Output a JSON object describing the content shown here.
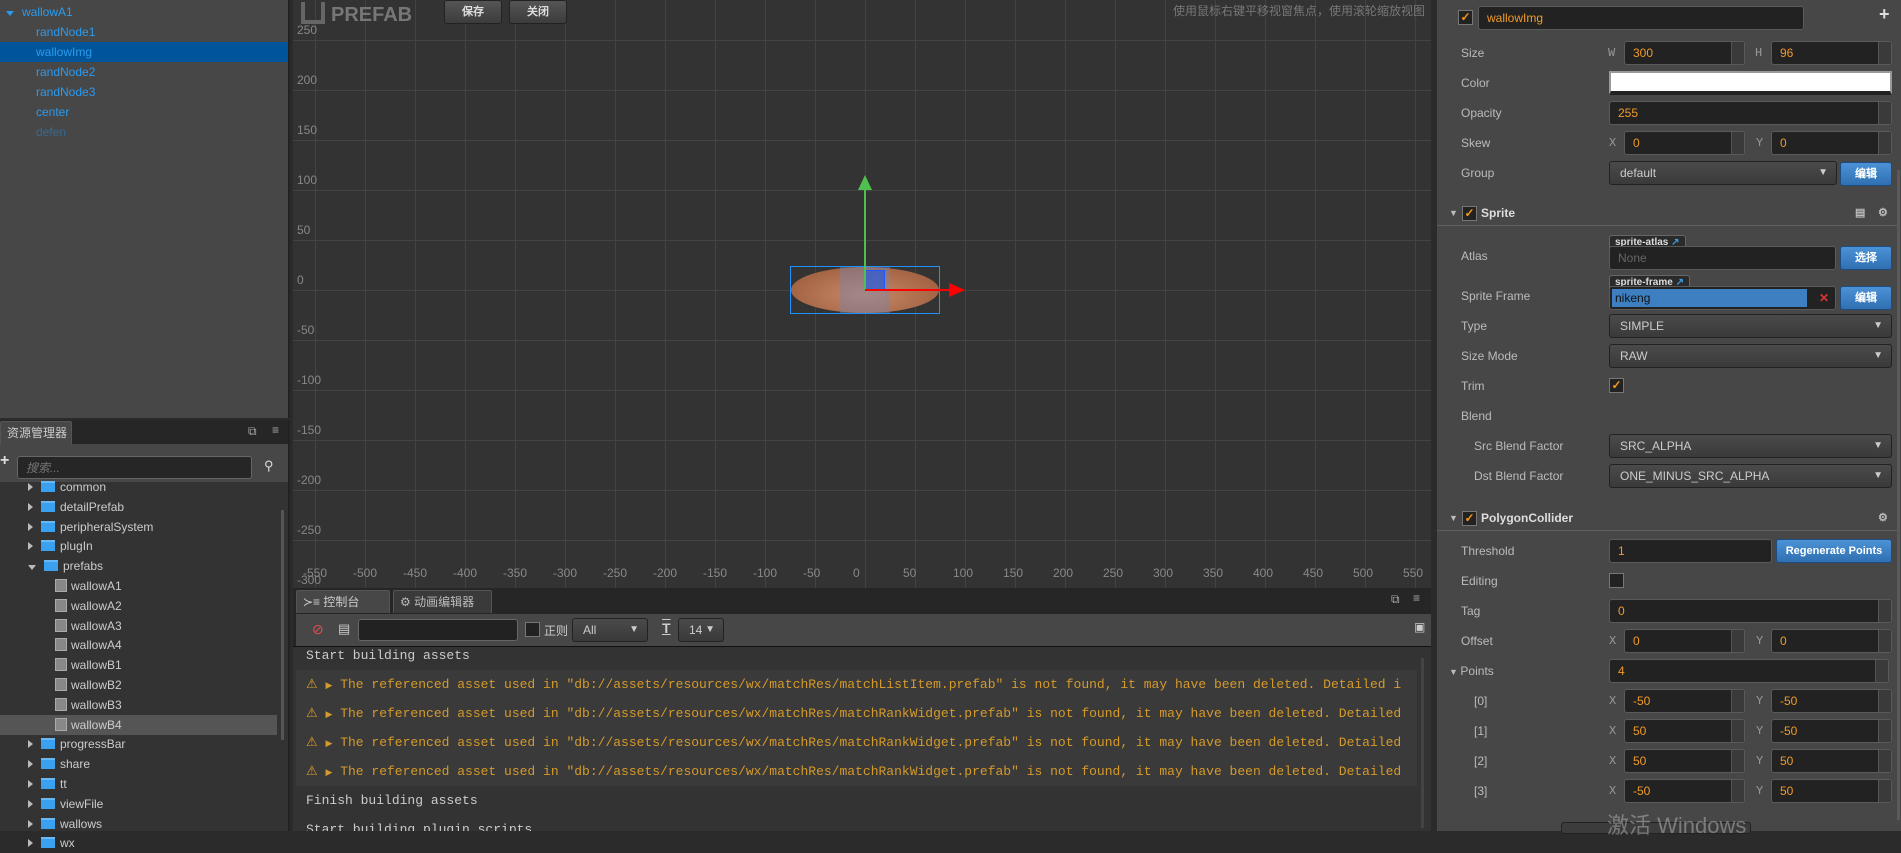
{
  "hierarchy": {
    "root": "wallowA1",
    "items": [
      "randNode1",
      "wallowImg",
      "randNode2",
      "randNode3",
      "center",
      "defen"
    ],
    "selected": "wallowImg"
  },
  "assets": {
    "tab": "资源管理器",
    "search_placeholder": "搜索...",
    "folders_top": [
      "common",
      "detailPrefab",
      "peripheralSystem",
      "plugIn",
      "prefabs"
    ],
    "prefabs": [
      "wallowA1",
      "wallowA2",
      "wallowA3",
      "wallowA4",
      "wallowB1",
      "wallowB2",
      "wallowB3",
      "wallowB4"
    ],
    "folders_bottom": [
      "progressBar",
      "share",
      "tt",
      "viewFile",
      "wallows",
      "wx"
    ],
    "selected": "wallowB4"
  },
  "scene": {
    "mode": "PREFAB",
    "save": "保存",
    "close": "关闭",
    "hint": "使用鼠标右键平移视窗焦点，使用滚轮缩放视图",
    "x_ticks": [
      -550,
      -500,
      -450,
      -400,
      -350,
      -300,
      -250,
      -200,
      -150,
      -100,
      -50,
      0,
      50,
      100,
      150,
      200,
      250,
      300,
      350,
      400,
      450,
      500,
      550
    ],
    "y_ticks": [
      250,
      200,
      150,
      100,
      50,
      0,
      -50,
      -100,
      -150,
      -200,
      -250,
      -300
    ],
    "node": {
      "width": 300,
      "height": 96
    }
  },
  "console": {
    "tab_console": "控制台",
    "tab_anim": "动画编辑器",
    "regex_label": "正则",
    "level": "All",
    "font_size": "14",
    "logs": [
      {
        "type": "info",
        "text": "Start building assets"
      },
      {
        "type": "warn",
        "text": "The referenced asset used in \"db://assets/resources/wx/matchRes/matchListItem.prefab\" is not found, it may have been deleted. Detailed i"
      },
      {
        "type": "warn",
        "text": "The referenced asset used in \"db://assets/resources/wx/matchRes/matchRankWidget.prefab\" is not found, it may have been deleted. Detailed"
      },
      {
        "type": "warn",
        "text": "The referenced asset used in \"db://assets/resources/wx/matchRes/matchRankWidget.prefab\" is not found, it may have been deleted. Detailed"
      },
      {
        "type": "warn",
        "text": "The referenced asset used in \"db://assets/resources/wx/matchRes/matchRankWidget.prefab\" is not found, it may have been deleted. Detailed"
      },
      {
        "type": "info",
        "text": "Finish building assets"
      },
      {
        "type": "info",
        "text": "Start building plugin scripts"
      }
    ]
  },
  "inspector": {
    "node_name": "wallowImg",
    "size": {
      "label": "Size",
      "w_label": "W",
      "w": "300",
      "h_label": "H",
      "h": "96"
    },
    "color": {
      "label": "Color",
      "value": "#ffffff"
    },
    "opacity": {
      "label": "Opacity",
      "value": "255"
    },
    "skew": {
      "label": "Skew",
      "x": "0",
      "y": "0"
    },
    "group": {
      "label": "Group",
      "value": "default",
      "edit": "编辑"
    },
    "sprite": {
      "title": "Sprite",
      "atlas_label": "Atlas",
      "atlas_chip": "sprite-atlas",
      "atlas_value": "None",
      "atlas_btn": "选择",
      "frame_label": "Sprite Frame",
      "frame_chip": "sprite-frame",
      "frame_value": "nikeng",
      "frame_btn": "编辑",
      "type_label": "Type",
      "type": "SIMPLE",
      "sizemode_label": "Size Mode",
      "sizemode": "RAW",
      "trim_label": "Trim",
      "trim": true,
      "blend_label": "Blend",
      "src_label": "Src Blend Factor",
      "src": "SRC_ALPHA",
      "dst_label": "Dst Blend Factor",
      "dst": "ONE_MINUS_SRC_ALPHA"
    },
    "collider": {
      "title": "PolygonCollider",
      "threshold_label": "Threshold",
      "threshold": "1",
      "regen": "Regenerate Points",
      "editing_label": "Editing",
      "editing": false,
      "tag_label": "Tag",
      "tag": "0",
      "offset_label": "Offset",
      "offset_x": "0",
      "offset_y": "0",
      "points_label": "Points",
      "points_count": "4",
      "points": [
        {
          "label": "[0]",
          "x": "-50",
          "y": "-50"
        },
        {
          "label": "[1]",
          "x": "50",
          "y": "-50"
        },
        {
          "label": "[2]",
          "x": "50",
          "y": "50"
        },
        {
          "label": "[3]",
          "x": "-50",
          "y": "50"
        }
      ]
    },
    "x_label": "X",
    "y_label": "Y"
  },
  "watermark": "激活 Windows",
  "colors": {
    "accent": "#2a9bf0",
    "selected": "#00559a",
    "warn": "#d59a2a",
    "value": "#f09a2a",
    "button": "#3d7fc1"
  }
}
